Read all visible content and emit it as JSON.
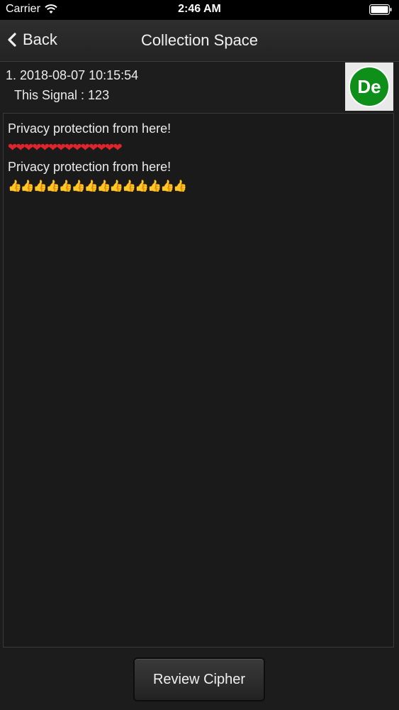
{
  "status_bar": {
    "carrier": "Carrier",
    "time": "2:46 AM",
    "wifi_icon": "wifi-icon",
    "battery_icon": "battery-icon"
  },
  "nav": {
    "back_label": "Back",
    "title": "Collection Space"
  },
  "entry": {
    "line": "1. 2018-08-07 10:15:54",
    "signal": "This Signal : 123",
    "avatar_text": "De",
    "avatar_color": "#0d8f1a"
  },
  "content": {
    "lines": [
      {
        "text": "Privacy protection from here!"
      },
      {
        "emoji": "❤❤❤❤❤❤❤❤❤❤❤❤❤❤",
        "kind": "heart"
      },
      {
        "text": "Privacy protection from here!"
      },
      {
        "emoji": "👍👍👍👍👍👍👍👍👍👍👍👍👍👍",
        "kind": "thumb"
      }
    ]
  },
  "footer": {
    "review_label": "Review Cipher"
  }
}
